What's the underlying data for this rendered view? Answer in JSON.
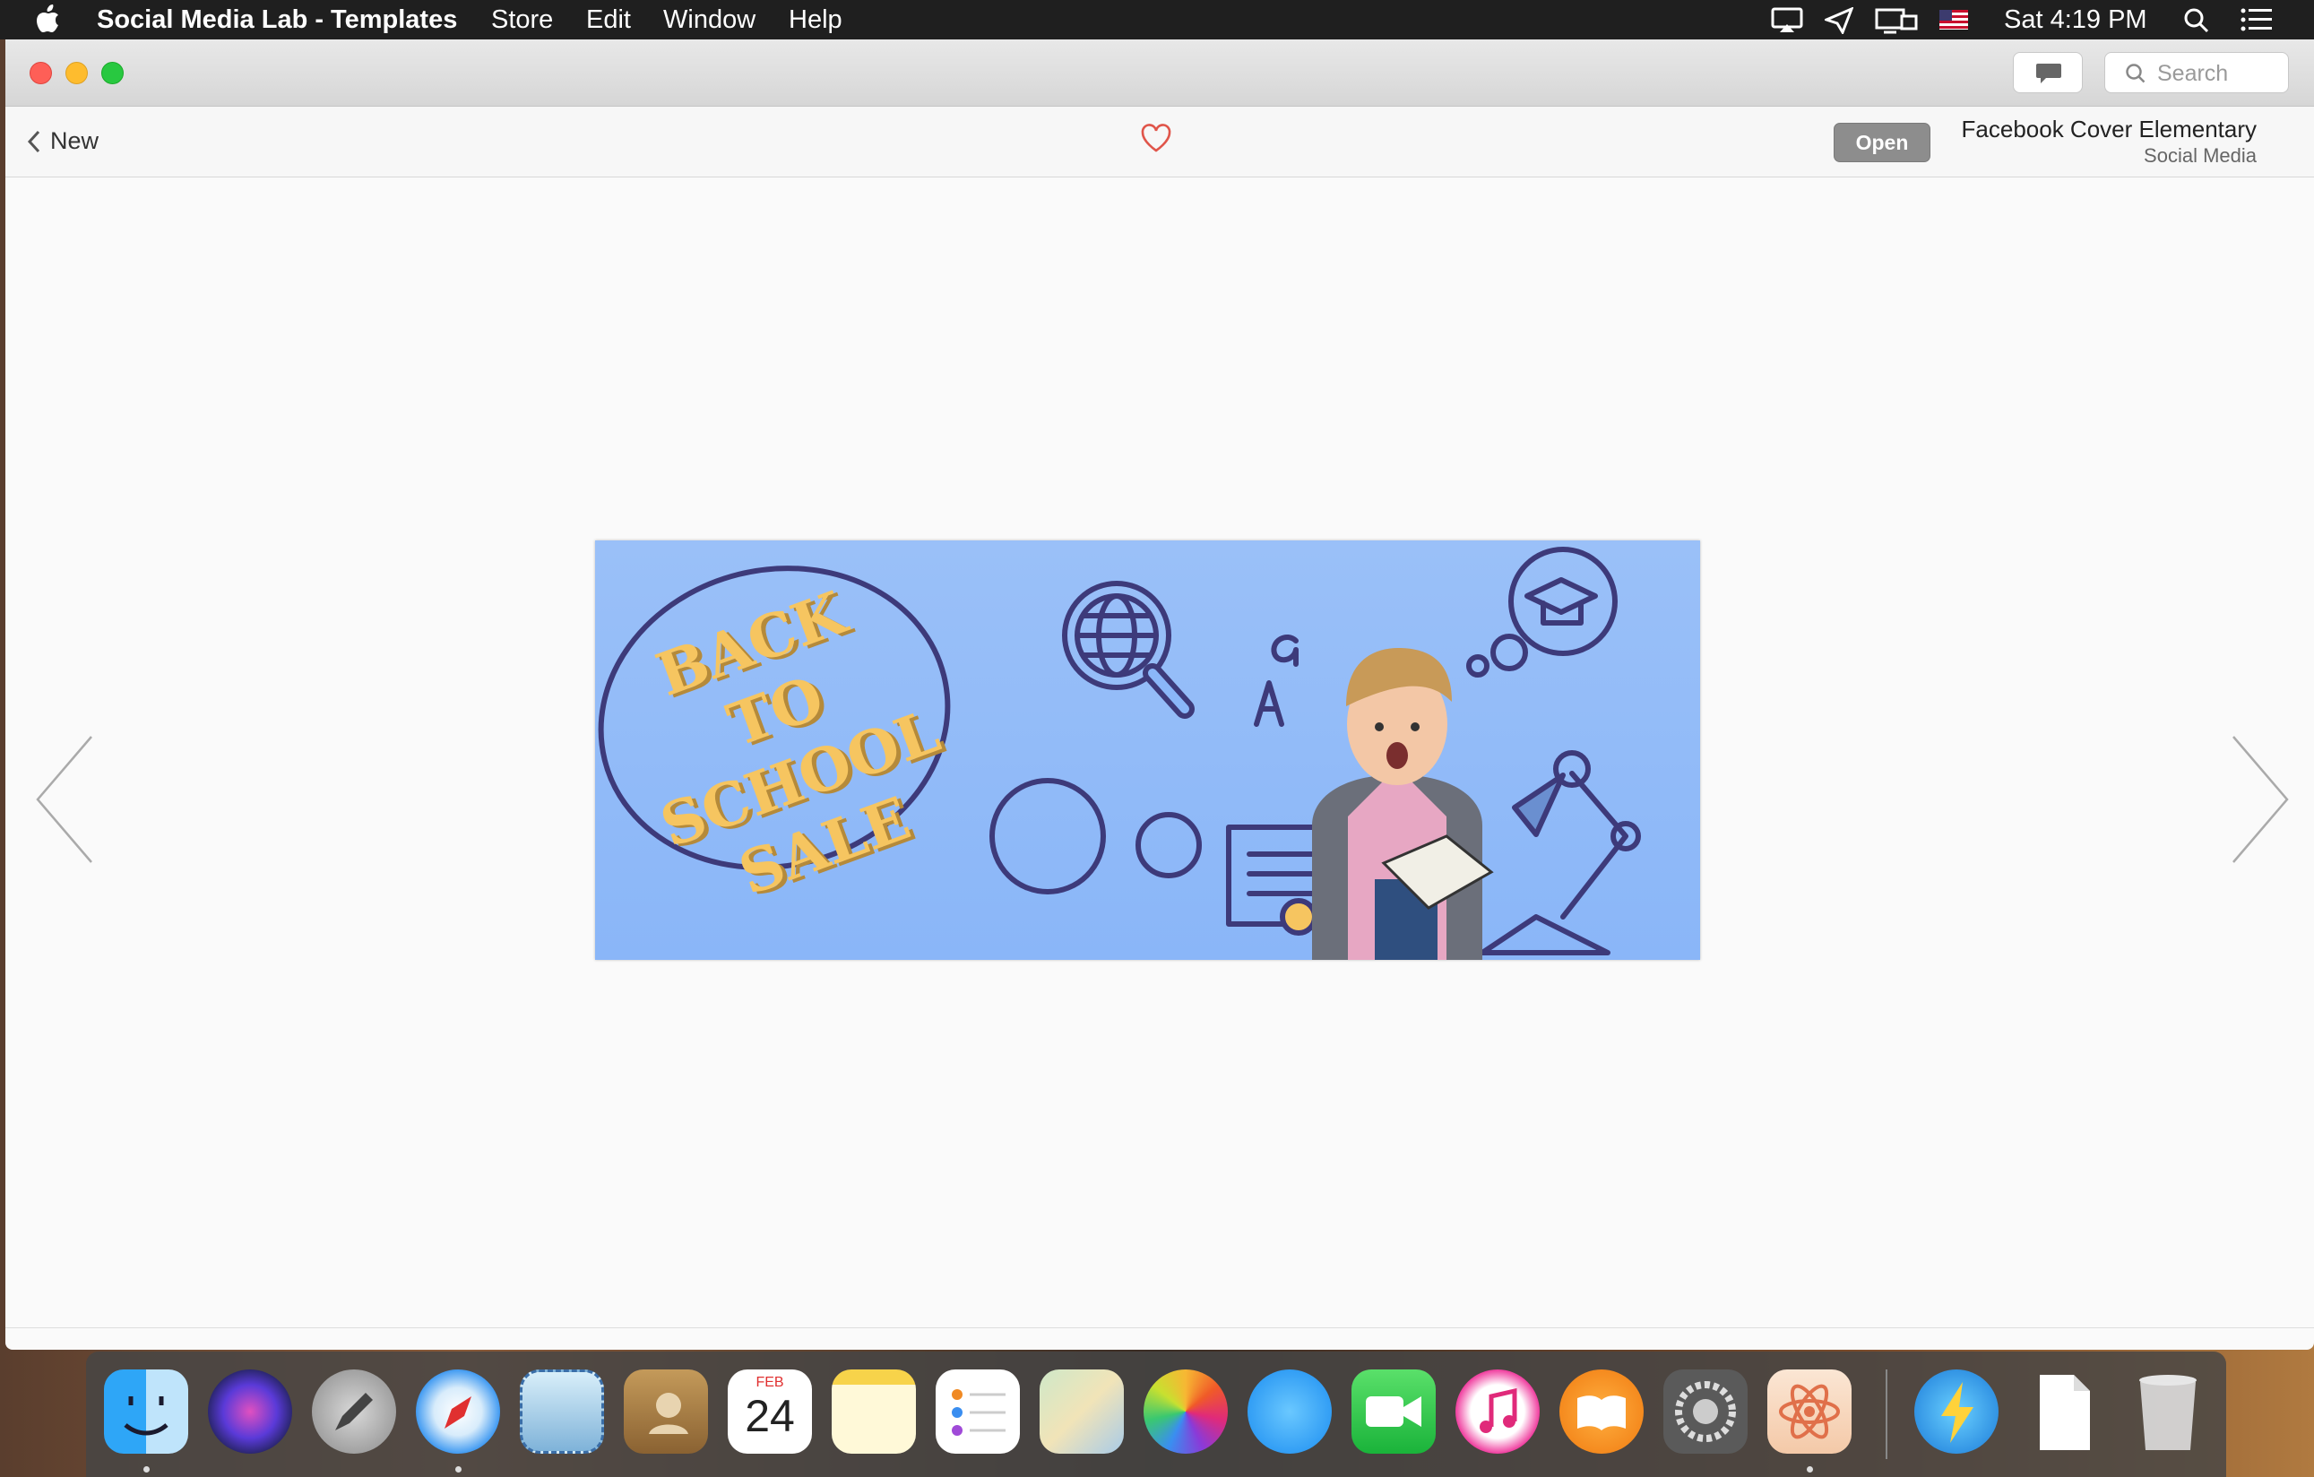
{
  "menubar": {
    "app_name": "Social Media Lab - Templates",
    "menus": [
      "Store",
      "Edit",
      "Window",
      "Help"
    ],
    "clock": "Sat 4:19 PM"
  },
  "window": {
    "search_placeholder": "Search"
  },
  "toolbar": {
    "back_label": "New",
    "open_label": "Open",
    "template_title": "Facebook Cover Elementary",
    "template_category": "Social Media"
  },
  "preview": {
    "headline_lines": [
      "BACK TO",
      "SCHOOL",
      "SALE"
    ],
    "colors": {
      "background": "#8ab6f8",
      "line_art": "#3d3a7a",
      "headline": "#f6c560"
    }
  },
  "dock": {
    "apps": [
      "Finder",
      "Siri",
      "Launchpad",
      "Safari",
      "Mail",
      "Contacts",
      "Calendar",
      "Notes",
      "Reminders",
      "Maps",
      "Photos",
      "Messages",
      "FaceTime",
      "iTunes",
      "iBooks",
      "System Preferences",
      "Social Media Lab",
      "Transmit",
      "Document",
      "Trash"
    ],
    "calendar_month": "FEB",
    "calendar_day": "24"
  }
}
